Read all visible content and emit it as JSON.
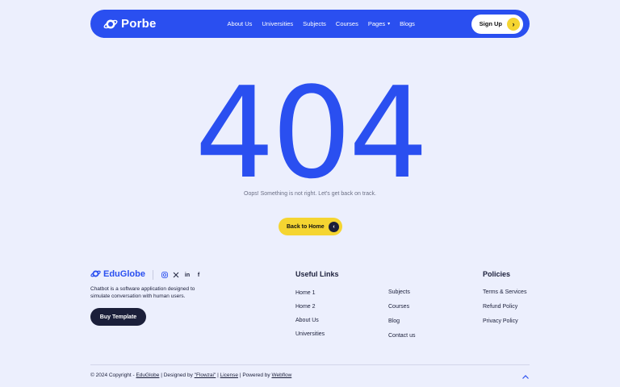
{
  "colors": {
    "primary": "#2a4ff0",
    "accent": "#f5d531",
    "dark": "#1b1f3a",
    "background": "#eceffd"
  },
  "nav": {
    "brand": "Porbe",
    "brand_icon": "planet-icon",
    "items": [
      {
        "label": "About Us"
      },
      {
        "label": "Universities"
      },
      {
        "label": "Subjects"
      },
      {
        "label": "Courses"
      },
      {
        "label": "Pages",
        "dropdown": true
      },
      {
        "label": "Blogs"
      }
    ],
    "signup_label": "Sign Up",
    "signup_icon": "chevron-right-icon"
  },
  "error": {
    "code": "404",
    "message": "Oops! Something is not right. Let's get back on track.",
    "back_label": "Back to Home",
    "back_icon": "chevron-left-icon"
  },
  "footer": {
    "brand": "EduGlobe",
    "socials": [
      "instagram-icon",
      "x-icon",
      "linkedin-icon",
      "facebook-icon"
    ],
    "description": "Chatbot is a software application designed to simulate conversation with human users.",
    "buy_label": "Buy Template",
    "useful_links_title": "Useful Links",
    "useful_links_col1": [
      "Home 1",
      "Home 2",
      "About Us",
      "Universities"
    ],
    "useful_links_col2": [
      "Subjects",
      "Courses",
      "Blog",
      "Contact us"
    ],
    "policies_title": "Policies",
    "policies": [
      "Terms & Services",
      "Refund Policy",
      "Privacy Policy"
    ],
    "copyright": {
      "prefix": "© 2024 Copyright - ",
      "brand": "EduGlobe",
      "designed": " | Designed by ",
      "designer": "\"Flowzai\"",
      "sep": " | ",
      "license": "License",
      "powered": " | Powered by ",
      "webflow": "Webflow"
    },
    "back_to_top_icon": "chevron-up-icon"
  }
}
